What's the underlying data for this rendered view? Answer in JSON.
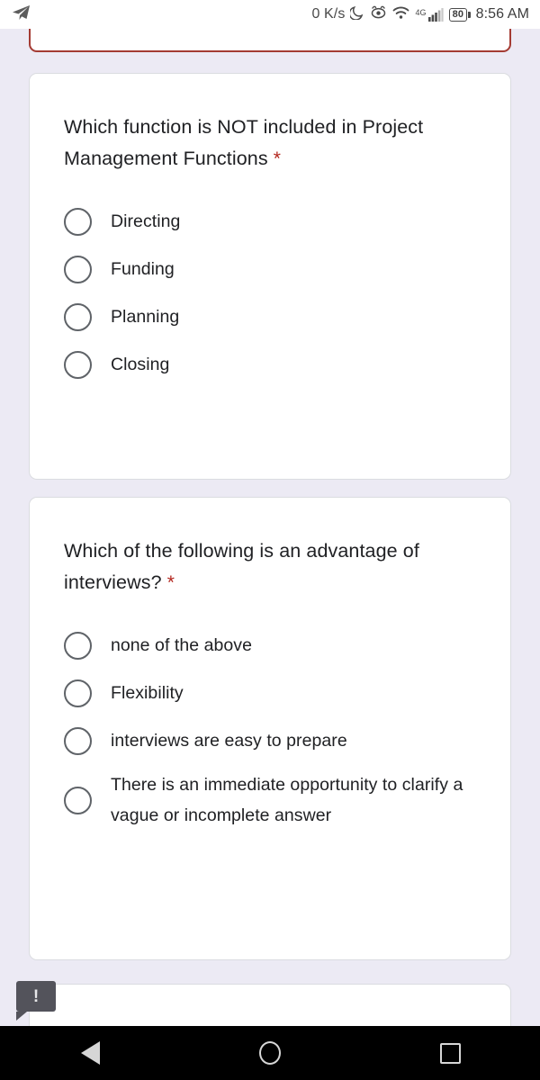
{
  "status_bar": {
    "app_icon": "telegram-plane-icon",
    "network_speed": "0 K/s",
    "icons": [
      "moon-icon",
      "eye-care-icon",
      "wifi-icon",
      "signal-4g-icon"
    ],
    "signal_generation": "4G",
    "battery_level": "80",
    "clock": "8:56 AM"
  },
  "form": {
    "background_color": "#eceaf4",
    "invalid_border_color": "#a43b33",
    "required_star": "*",
    "questions": [
      {
        "title": "Which function is NOT included in Project Management Functions",
        "required": true,
        "options": [
          {
            "label": "Directing",
            "selected": false
          },
          {
            "label": "Funding",
            "selected": false
          },
          {
            "label": "Planning",
            "selected": false
          },
          {
            "label": "Closing",
            "selected": false
          }
        ]
      },
      {
        "title": "Which of the following is an advantage of interviews?",
        "required": true,
        "options": [
          {
            "label": "none of the above",
            "selected": false
          },
          {
            "label": "Flexibility",
            "selected": false
          },
          {
            "label": "interviews are easy to prepare",
            "selected": false
          },
          {
            "label": "There is an immediate opportunity to clarify a vague or incomplete answer",
            "selected": false
          }
        ]
      }
    ],
    "error_badge": {
      "icon": "exclamation-icon",
      "text": "!"
    }
  },
  "nav_bar": {
    "back": "back-icon",
    "home": "home-icon",
    "recents": "recents-icon"
  }
}
